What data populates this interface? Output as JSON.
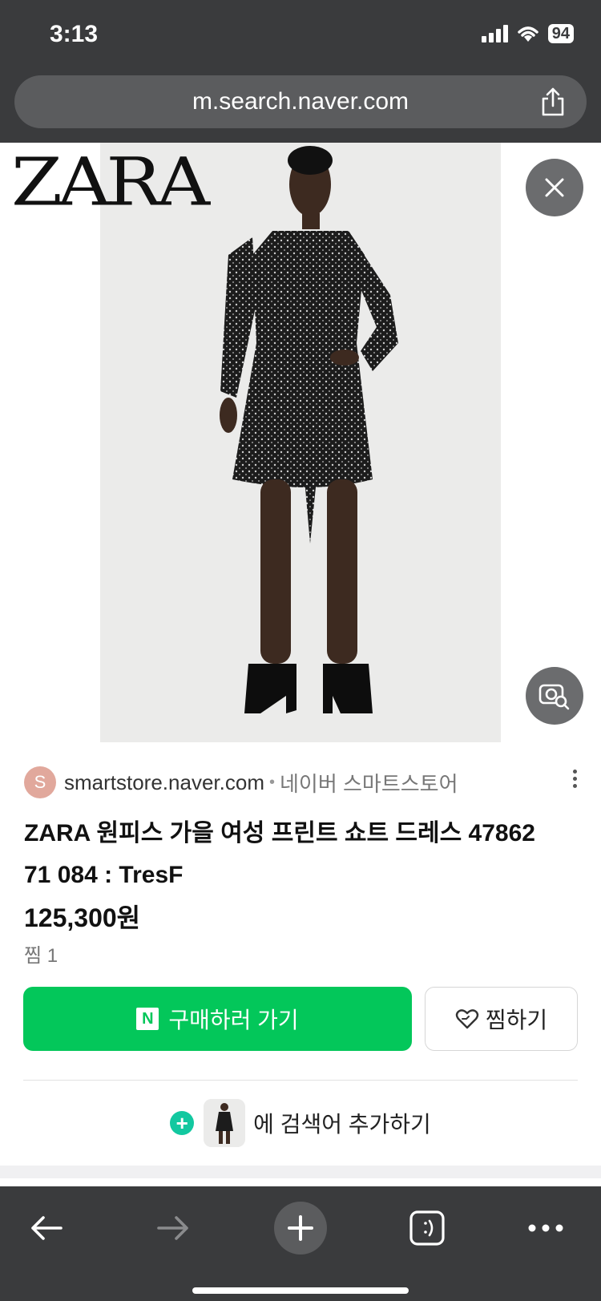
{
  "status_bar": {
    "time": "3:13",
    "battery": "94"
  },
  "browser": {
    "url": "m.search.naver.com"
  },
  "image_viewer": {
    "brand_logo": "ZARA"
  },
  "product": {
    "source_initial": "S",
    "source_domain": "smartstore.naver.com",
    "source_separator": "•",
    "source_store": "네이버 스마트스토어",
    "title_line1": "ZARA 원피스 가을 여성 프린트 쇼트 드레스 47862",
    "title_line2": "71 084 : TresF",
    "price": "125,300원",
    "likes": "찜 1"
  },
  "actions": {
    "buy_label": "구매하러 가기",
    "buy_badge": "N",
    "like_label": "찜하기",
    "add_search_label": "에 검색어 추가하기"
  },
  "colors": {
    "brand_green": "#03c75a",
    "browser_chrome": "#3a3b3d",
    "add_accent": "#12c8a0"
  },
  "icons": [
    "signal-icon",
    "wifi-icon",
    "share-icon",
    "close-icon",
    "lens-search-icon",
    "more-vertical-icon",
    "heart-icon",
    "plus-icon",
    "back-arrow-icon",
    "forward-arrow-icon",
    "new-tab-icon",
    "tabs-icon",
    "more-horizontal-icon"
  ]
}
